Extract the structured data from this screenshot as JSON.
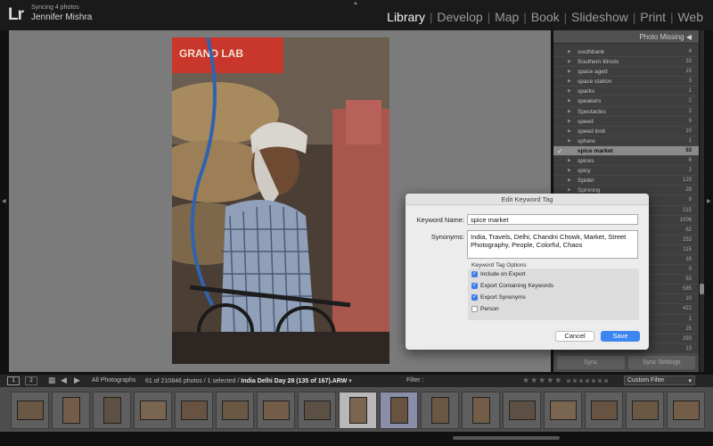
{
  "identity": {
    "logo": "Lr",
    "sync_status": "Syncing 4 photos",
    "user": "Jennifer Mishra"
  },
  "modules": [
    "Library",
    "Develop",
    "Map",
    "Book",
    "Slideshow",
    "Print",
    "Web"
  ],
  "active_module": "Library",
  "right_panel": {
    "header": "Photo Missing",
    "keywords": [
      {
        "name": "southbank",
        "count": "4"
      },
      {
        "name": "Southern Illinois",
        "count": "33"
      },
      {
        "name": "space aged",
        "count": "15"
      },
      {
        "name": "space station",
        "count": "3"
      },
      {
        "name": "sparks",
        "count": "1"
      },
      {
        "name": "speakers",
        "count": "2"
      },
      {
        "name": "Spectacles",
        "count": "2"
      },
      {
        "name": "speed",
        "count": "9"
      },
      {
        "name": "speed limit",
        "count": "10"
      },
      {
        "name": "sphere",
        "count": "1"
      },
      {
        "name": "spice market",
        "count": "53",
        "selected": true,
        "checked": true
      },
      {
        "name": "spices",
        "count": "6"
      },
      {
        "name": "spicy",
        "count": "2"
      },
      {
        "name": "Spider",
        "count": "120"
      },
      {
        "name": "Spinning",
        "count": "28"
      },
      {
        "name": "",
        "count": "8"
      },
      {
        "name": "",
        "count": "215"
      },
      {
        "name": "",
        "count": "1006"
      },
      {
        "name": "",
        "count": "62"
      },
      {
        "name": "",
        "count": "253"
      },
      {
        "name": "",
        "count": "115"
      },
      {
        "name": "",
        "count": "19"
      },
      {
        "name": "",
        "count": "9"
      },
      {
        "name": "",
        "count": "53"
      },
      {
        "name": "",
        "count": "585"
      },
      {
        "name": "",
        "count": "10"
      },
      {
        "name": "",
        "count": "422"
      },
      {
        "name": "",
        "count": "1"
      },
      {
        "name": "",
        "count": "25"
      },
      {
        "name": "",
        "count": "293"
      },
      {
        "name": "",
        "count": "13"
      }
    ],
    "sync_label": "Sync",
    "sync_settings_label": "Sync Settings"
  },
  "toolbar": {
    "monitor_1": "1",
    "monitor_2": "2",
    "source": "All Photographs",
    "count_text": "61 of 210846 photos / 1 selected / ",
    "current_file": "India Delhi Day 28 (135 of 167).ARW",
    "current_suffix": " ▾",
    "filter_label": "Filter :",
    "stars": "★★★★★",
    "custom_filter": "Custom Filter"
  },
  "filmstrip": {
    "cells": [
      {
        "num": "",
        "tall": false,
        "state": ""
      },
      {
        "num": "",
        "tall": true,
        "state": ""
      },
      {
        "num": "",
        "tall": true,
        "state": ""
      },
      {
        "num": "",
        "tall": false,
        "state": ""
      },
      {
        "num": "",
        "tall": false,
        "state": ""
      },
      {
        "num": "",
        "tall": false,
        "state": ""
      },
      {
        "num": "",
        "tall": false,
        "state": ""
      },
      {
        "num": "",
        "tall": false,
        "state": ""
      },
      {
        "num": "",
        "tall": true,
        "state": "active"
      },
      {
        "num": "",
        "tall": true,
        "state": "selected"
      },
      {
        "num": "",
        "tall": true,
        "state": ""
      },
      {
        "num": "",
        "tall": true,
        "state": ""
      },
      {
        "num": "",
        "tall": false,
        "state": ""
      },
      {
        "num": "",
        "tall": false,
        "state": ""
      },
      {
        "num": "",
        "tall": false,
        "state": ""
      },
      {
        "num": "",
        "tall": false,
        "state": ""
      },
      {
        "num": "",
        "tall": false,
        "state": ""
      }
    ]
  },
  "dialog": {
    "title": "Edit Keyword Tag",
    "keyword_name_label": "Keyword Name:",
    "keyword_name_value": "spice market",
    "synonyms_label": "Synonyms:",
    "synonyms_value": "India, Travels, Delhi, Chandni Chowk, Market, Street Photography, People, Colorful, Chaos",
    "options_title": "Keyword Tag Options",
    "options": [
      {
        "label": "Include on Export",
        "checked": true
      },
      {
        "label": "Export Containing Keywords",
        "checked": true
      },
      {
        "label": "Export Synonyms",
        "checked": true
      },
      {
        "label": "Person",
        "checked": false
      }
    ],
    "cancel_label": "Cancel",
    "save_label": "Save"
  },
  "colors": {
    "accent_blue": "#3d86f2",
    "loupe_bg": "#7b7b7b",
    "panel_bg": "#3e3e3e"
  }
}
